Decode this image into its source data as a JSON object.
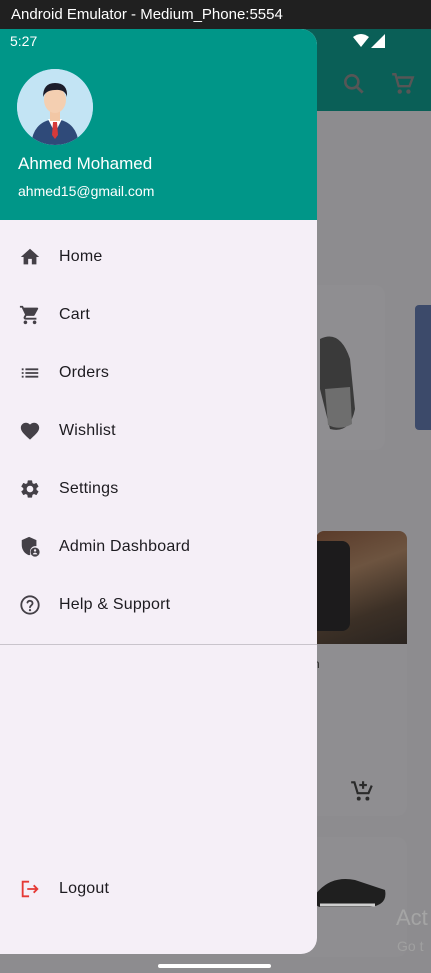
{
  "window": {
    "title": "Android Emulator - Medium_Phone:5554"
  },
  "status_bar": {
    "time": "5:27"
  },
  "user": {
    "name": "Ahmed Mohamed",
    "email": "ahmed15@gmail.com"
  },
  "menu": {
    "items": [
      {
        "label": "Home",
        "icon": "home-icon"
      },
      {
        "label": "Cart",
        "icon": "cart-icon"
      },
      {
        "label": "Orders",
        "icon": "list-icon"
      },
      {
        "label": "Wishlist",
        "icon": "heart-icon"
      },
      {
        "label": "Settings",
        "icon": "gear-icon"
      },
      {
        "label": "Admin Dashboard",
        "icon": "admin-shield-icon"
      },
      {
        "label": "Help & Support",
        "icon": "help-icon"
      }
    ],
    "logout_label": "Logout"
  },
  "background": {
    "activate_title": "Act",
    "activate_sub": "Go t",
    "product_label_fragment": "n"
  },
  "colors": {
    "header": "#009688",
    "drawer_bg": "#f5eff7",
    "logout_icon": "#e53935"
  }
}
